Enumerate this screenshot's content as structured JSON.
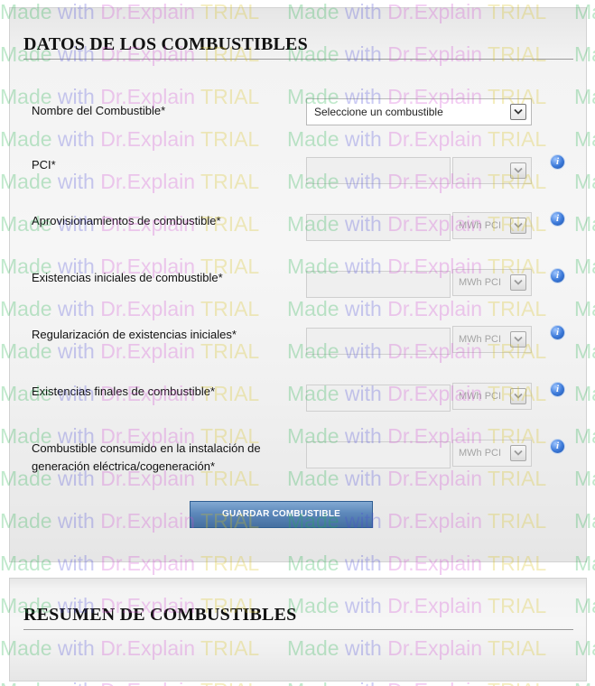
{
  "panel_fuel": {
    "title": "DATOS DE LOS COMBUSTIBLES",
    "fuel_name_label": "Nombre del Combustible*",
    "fuel_select_value": "Seleccione un combustible",
    "pci_label": "PCI*",
    "supplies_label": "Aprovisionamientos de combustible*",
    "initial_stock_label": "Existencias iniciales de combustible*",
    "initial_stock_regularization_label": "Regularización de existencias iniciales*",
    "final_stock_label": "Existencias finales de combustible*",
    "consumed_label": "Combustible consumido en la instalación de generación eléctrica/cogeneración*",
    "unit_value": "MWh PCI",
    "info_glyph": "i",
    "save_button_label": "GUARDAR COMBUSTIBLE"
  },
  "panel_summary": {
    "title": "RESUMEN DE COMBUSTIBLES"
  },
  "watermark": {
    "made": "Made",
    "with": "with",
    "brand": "Dr.Explain",
    "trial": "TRIAL"
  },
  "colors": {
    "button_top": "#82a9d2",
    "button_bottom": "#456f9f",
    "info_icon": "#3a78d8",
    "watermark_made": "#22b14c",
    "watermark_with": "#4a4ad8",
    "watermark_brand": "#d24ad2",
    "watermark_trial": "#d8c21a"
  },
  "icons": {
    "dropdown": "chevron-down-icon",
    "info": "info-icon"
  }
}
